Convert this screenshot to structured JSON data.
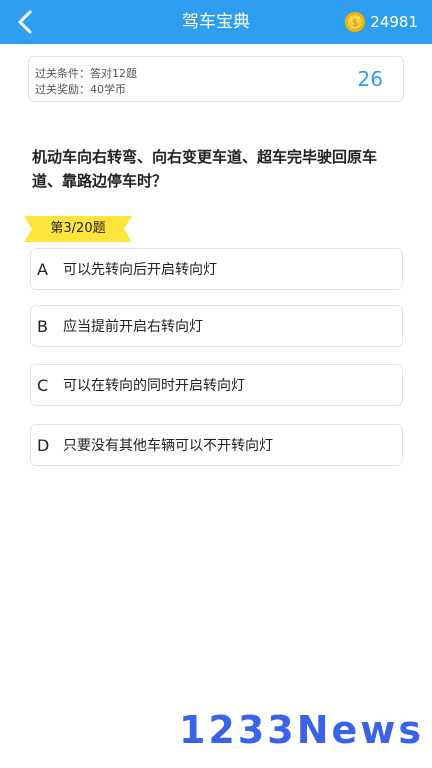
{
  "header": {
    "title": "驾车宝典",
    "coins": "24981",
    "back_icon": "chevron-left-icon",
    "coin_icon": "gold-coin-icon"
  },
  "conditions": {
    "pass_condition": "过关条件：答对12题",
    "pass_reward": "过关奖励：40学币",
    "counter": "26"
  },
  "question": {
    "text": "机动车向右转弯、向右变更车道、超车完毕驶回原车道、靠路边停车时？",
    "progress": "第3/20题"
  },
  "options": [
    {
      "letter": "A",
      "text": "可以先转向后开启转向灯"
    },
    {
      "letter": "B",
      "text": "应当提前开启右转向灯"
    },
    {
      "letter": "C",
      "text": "可以在转向的同时开启转向灯"
    },
    {
      "letter": "D",
      "text": "只要没有其他车辆可以不开转向灯"
    }
  ],
  "watermark": "1233News",
  "colors": {
    "header_bg": "#2e9ff0",
    "accent": "#2e9ff0",
    "progress_tag": "#ffe53b",
    "watermark": "#3b63e8"
  }
}
